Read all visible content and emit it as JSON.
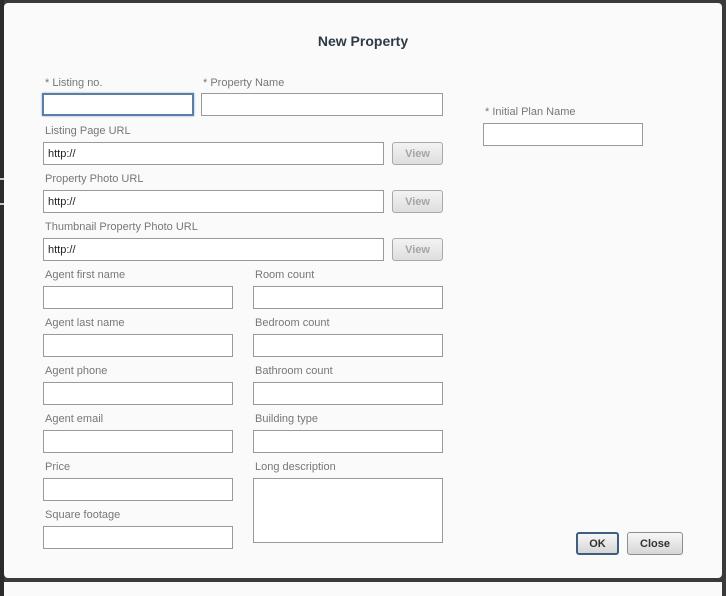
{
  "dialog": {
    "title": "New Property",
    "fields": {
      "listing_no": {
        "label": "* Listing no.",
        "value": ""
      },
      "property_name": {
        "label": "* Property Name",
        "value": ""
      },
      "initial_plan_name": {
        "label": "* Initial Plan Name",
        "value": ""
      },
      "listing_page_url": {
        "label": "Listing Page URL",
        "value": "http://"
      },
      "property_photo_url": {
        "label": "Property Photo URL",
        "value": "http://"
      },
      "thumbnail_photo_url": {
        "label": "Thumbnail Property Photo URL",
        "value": "http://"
      },
      "agent_first_name": {
        "label": "Agent first name",
        "value": ""
      },
      "room_count": {
        "label": "Room count",
        "value": ""
      },
      "agent_last_name": {
        "label": "Agent last name",
        "value": ""
      },
      "bedroom_count": {
        "label": "Bedroom count",
        "value": ""
      },
      "agent_phone": {
        "label": "Agent phone",
        "value": ""
      },
      "bathroom_count": {
        "label": "Bathroom count",
        "value": ""
      },
      "agent_email": {
        "label": "Agent email",
        "value": ""
      },
      "building_type": {
        "label": "Building type",
        "value": ""
      },
      "price": {
        "label": "Price",
        "value": ""
      },
      "long_description": {
        "label": "Long description",
        "value": ""
      },
      "square_footage": {
        "label": "Square footage",
        "value": ""
      }
    },
    "buttons": {
      "view": "View",
      "ok": "OK",
      "close": "Close"
    }
  }
}
